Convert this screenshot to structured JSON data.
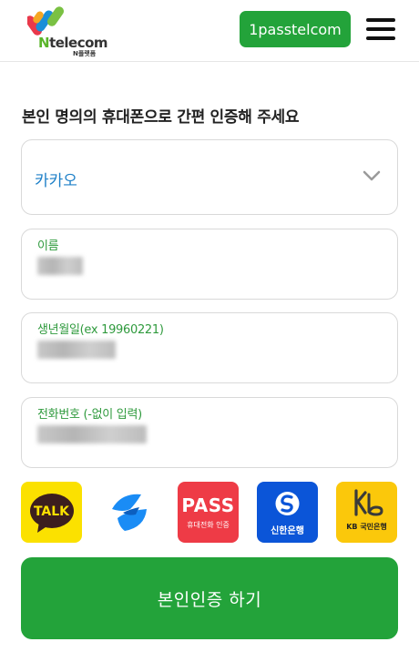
{
  "header": {
    "logo_word_prefix": "N",
    "logo_word_rest": "telecom",
    "logo_subtext": "N플랫폼",
    "brand_button": "1passtelcom",
    "menu_icon": "hamburger-menu-icon"
  },
  "form": {
    "title": "본인 명의의 휴대폰으로 간편 인증해 주세요",
    "carrier": {
      "selected": "카카오",
      "icon": "chevron-down-icon"
    },
    "name_field": {
      "label": "이름",
      "value": ""
    },
    "birth_field": {
      "label": "생년월일(ex 19960221)",
      "value": ""
    },
    "phone_field": {
      "label": "전화번호 (-없이 입력)",
      "value": ""
    }
  },
  "providers": [
    {
      "name": "kakao",
      "text": "TALK",
      "color": "#fbe100"
    },
    {
      "name": "toss",
      "text": "",
      "color": "#1a8cf5"
    },
    {
      "name": "pass",
      "text": "PASS",
      "subtext": "휴대전화 인증",
      "color": "#ee3b46"
    },
    {
      "name": "shinhan",
      "text": "신한은행",
      "color": "#0b55d8"
    },
    {
      "name": "kb",
      "text": "KB 국민은행",
      "color": "#fbc80b"
    }
  ],
  "submit_button": "본인인증 하기",
  "colors": {
    "primary_green": "#23a33a",
    "label_green": "#2f9a3d",
    "select_blue": "#1e80c8"
  }
}
